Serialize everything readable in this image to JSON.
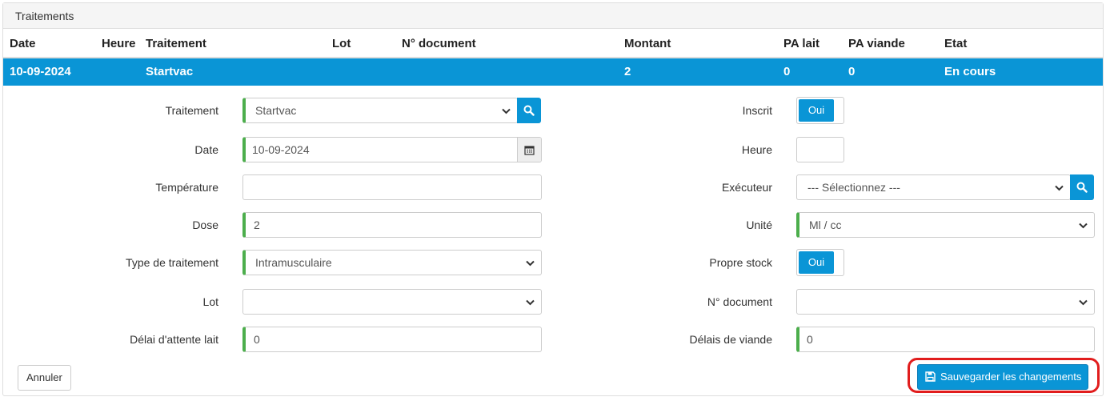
{
  "panel": {
    "title": "Traitements"
  },
  "table": {
    "headers": {
      "date": "Date",
      "heure": "Heure",
      "traitement": "Traitement",
      "lot": "Lot",
      "document": "N° document",
      "montant": "Montant",
      "pa_lait": "PA lait",
      "pa_viande": "PA viande",
      "etat": "Etat"
    },
    "row": {
      "date": "10-09-2024",
      "traitement": "Startvac",
      "montant": "2",
      "pa_lait": "0",
      "pa_viande": "0",
      "etat": "En cours"
    }
  },
  "form": {
    "traitement": {
      "label": "Traitement",
      "value": "Startvac"
    },
    "date": {
      "label": "Date",
      "value": "10-09-2024"
    },
    "temperature": {
      "label": "Température",
      "value": ""
    },
    "dose": {
      "label": "Dose",
      "value": "2"
    },
    "type": {
      "label": "Type de traitement",
      "value": "Intramusculaire"
    },
    "lot": {
      "label": "Lot",
      "value": ""
    },
    "delai_lait": {
      "label": "Délai d'attente lait",
      "value": "0"
    },
    "inscrit": {
      "label": "Inscrit",
      "value": "Oui"
    },
    "heure": {
      "label": "Heure",
      "value": ""
    },
    "executeur": {
      "label": "Exécuteur",
      "value": "--- Sélectionnez ---"
    },
    "unite": {
      "label": "Unité",
      "value": "Ml / cc"
    },
    "propre_stock": {
      "label": "Propre stock",
      "value": "Oui"
    },
    "document": {
      "label": "N° document",
      "value": ""
    },
    "delai_viande": {
      "label": "Délais de viande",
      "value": "0"
    }
  },
  "actions": {
    "cancel_label": "Annuler",
    "save_label": "Sauvegarder les changements"
  },
  "colors": {
    "primary": "#0a95d6",
    "required": "#4cae4c",
    "highlight": "#e11d1d"
  }
}
